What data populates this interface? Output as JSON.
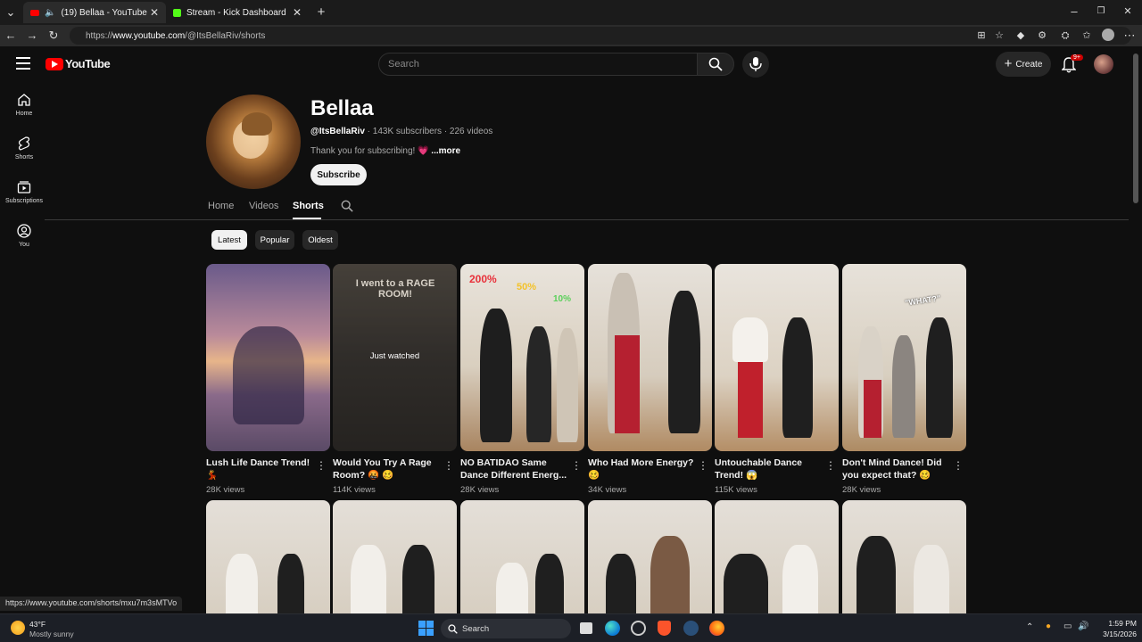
{
  "browser": {
    "tabs": [
      {
        "label": "(19) Bellaa - YouTube",
        "active": true
      },
      {
        "label": "Stream - Kick Dashboard",
        "active": false
      }
    ],
    "url_prefix": "https://",
    "url_host": "www.youtube.com",
    "url_path": "/@ItsBellaRiv/shorts"
  },
  "youtube": {
    "logo_text": "YouTube",
    "search_placeholder": "Search",
    "create_label": "Create",
    "notifications_badge": "9+",
    "sidebar": [
      {
        "label": "Home",
        "icon": "home-icon"
      },
      {
        "label": "Shorts",
        "icon": "shorts-icon"
      },
      {
        "label": "Subscriptions",
        "icon": "subscriptions-icon"
      },
      {
        "label": "You",
        "icon": "user-icon"
      }
    ],
    "channel": {
      "name": "Bellaa",
      "handle": "@ItsBellaRiv",
      "stats": " · 143K subscribers · 226 videos",
      "description": "Thank you for subscribing! 💗",
      "more": "...more",
      "subscribe_label": "Subscribe"
    },
    "tabs": [
      "Home",
      "Videos",
      "Shorts"
    ],
    "active_tab": "Shorts",
    "chips": [
      "Latest",
      "Popular",
      "Oldest"
    ],
    "selected_chip": "Latest",
    "shorts_row1": [
      {
        "title": "Lush Life Dance Trend! 💃",
        "views": "28K views"
      },
      {
        "title": "Would You Try A Rage Room? 🤬 🥴",
        "views": "114K views",
        "overlay": "Just watched",
        "thumb_text": "I went to a RAGE ROOM!"
      },
      {
        "title": "NO BATIDAO Same Dance Different Energ...",
        "views": "28K views",
        "thumb_text": [
          "200%",
          "50%",
          "10%"
        ]
      },
      {
        "title": "Who Had More Energy? 🥴",
        "views": "34K views"
      },
      {
        "title": "Untouchable Dance Trend! 😱",
        "views": "115K views"
      },
      {
        "title": "Don't Mind Dance! Did you expect that? 🥴",
        "views": "28K views",
        "thumb_text": "\"WHAT?\""
      }
    ],
    "status_url": "https://www.youtube.com/shorts/mxu7m3sMTVo"
  },
  "taskbar": {
    "weather_temp": "43°F",
    "weather_desc": "Mostly sunny",
    "search_label": "Search",
    "time": "1:59 PM",
    "date": "3/15/2026"
  }
}
